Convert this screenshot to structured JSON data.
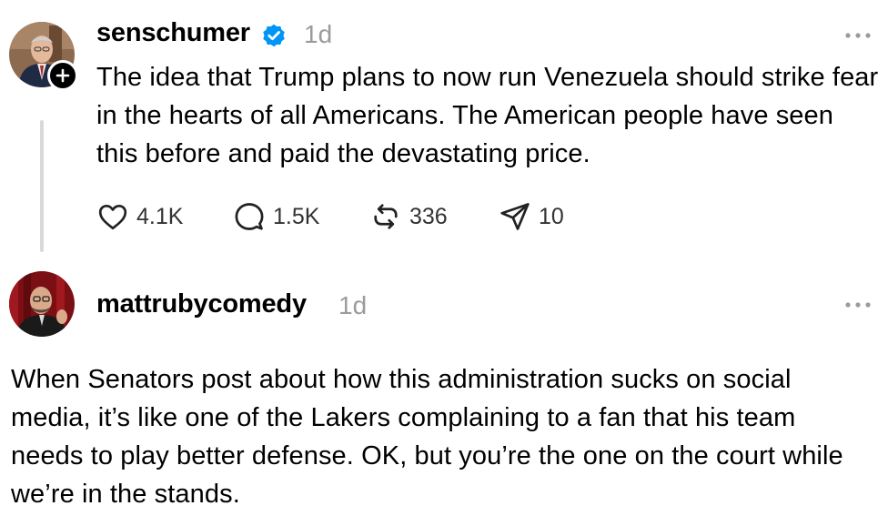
{
  "post": {
    "username": "senschumer",
    "verified": true,
    "timestamp": "1d",
    "text": "The idea that Trump plans to now run Venezuela should strike fear in the hearts of all Americans. The American people have seen this before and paid the devastating price.",
    "actions": {
      "likes": "4.1K",
      "replies": "1.5K",
      "reposts": "336",
      "shares": "10"
    }
  },
  "reply": {
    "username": "mattrubycomedy",
    "timestamp": "1d",
    "text": "When Senators post about how this administration sucks on social media, it’s like one of the Lakers complaining to a fan that his team needs to play better defense. OK, but you’re the one on the court while we’re in the stands."
  },
  "colors": {
    "verified_blue": "#0095f6",
    "muted_gray": "#9b9b9b",
    "thread_line": "#d9d9d9"
  },
  "icons": {
    "like": "heart-icon",
    "reply": "comment-bubble-icon",
    "repost": "repost-arrows-icon",
    "share": "send-paper-plane-icon",
    "more": "ellipsis-icon",
    "follow": "plus-icon",
    "verified": "verified-badge-icon"
  }
}
